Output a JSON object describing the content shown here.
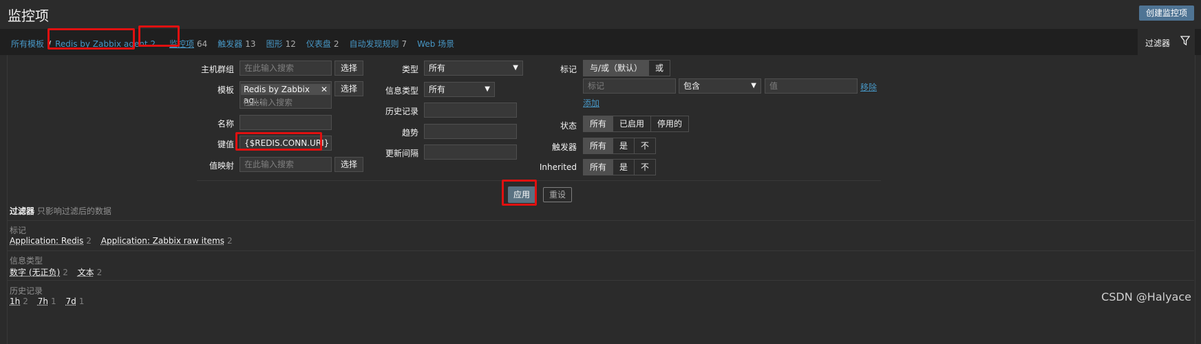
{
  "header": {
    "title": "监控项",
    "create_button": "创建监控项"
  },
  "nav": {
    "all_templates": "所有模板",
    "separator": "/",
    "template_name": "Redis by Zabbix agent 2",
    "tabs": [
      {
        "label": "监控项",
        "count": "64"
      },
      {
        "label": "触发器",
        "count": "13"
      },
      {
        "label": "图形",
        "count": "12"
      },
      {
        "label": "仪表盘",
        "count": "2"
      },
      {
        "label": "自动发现规则",
        "count": "7"
      },
      {
        "label": "Web 场景",
        "count": ""
      }
    ],
    "filter_tab": "过滤器"
  },
  "filter": {
    "host_group_label": "主机群组",
    "host_group_placeholder": "在此输入搜索",
    "select_label": "选择",
    "template_label": "模板",
    "template_chip": "Redis by Zabbix ag...",
    "template_placeholder": "在此输入搜索",
    "name_label": "名称",
    "name_value": "",
    "key_label": "键值",
    "key_value": "{$REDIS.CONN.URI}",
    "valuemap_label": "值映射",
    "valuemap_placeholder": "在此输入搜索",
    "type_label": "类型",
    "type_value": "所有",
    "info_type_label": "信息类型",
    "info_type_value": "所有",
    "history_label": "历史记录",
    "trend_label": "趋势",
    "interval_label": "更新间隔",
    "tags_label": "标记",
    "tags_mode": [
      "与/或（默认）",
      "或"
    ],
    "tag_placeholder": "标记",
    "tag_operator": "包含",
    "tag_value_placeholder": "值",
    "remove_link": "移除",
    "add_link": "添加",
    "state_label": "状态",
    "state_options": [
      "所有",
      "已启用",
      "停用的"
    ],
    "triggers_label": "触发器",
    "triggers_options": [
      "所有",
      "是",
      "不"
    ],
    "inherited_label": "Inherited",
    "inherited_options": [
      "所有",
      "是",
      "不"
    ],
    "apply_button": "应用",
    "reset_button": "重设"
  },
  "subfilter": {
    "title": "过滤器",
    "subtitle": "只影响过滤后的数据",
    "sections": [
      {
        "label": "标记",
        "values": [
          {
            "name": "Application: Redis",
            "count": "2"
          },
          {
            "name": "Application: Zabbix raw items",
            "count": "2"
          }
        ]
      },
      {
        "label": "信息类型",
        "values": [
          {
            "name": "数字 (无正负)",
            "count": "2"
          },
          {
            "name": "文本",
            "count": "2"
          }
        ]
      },
      {
        "label": "历史记录",
        "values": [
          {
            "name": "1h",
            "count": "2"
          },
          {
            "name": "7h",
            "count": "1"
          },
          {
            "name": "7d",
            "count": "1"
          }
        ]
      }
    ]
  },
  "watermark": "CSDN @Halyace"
}
